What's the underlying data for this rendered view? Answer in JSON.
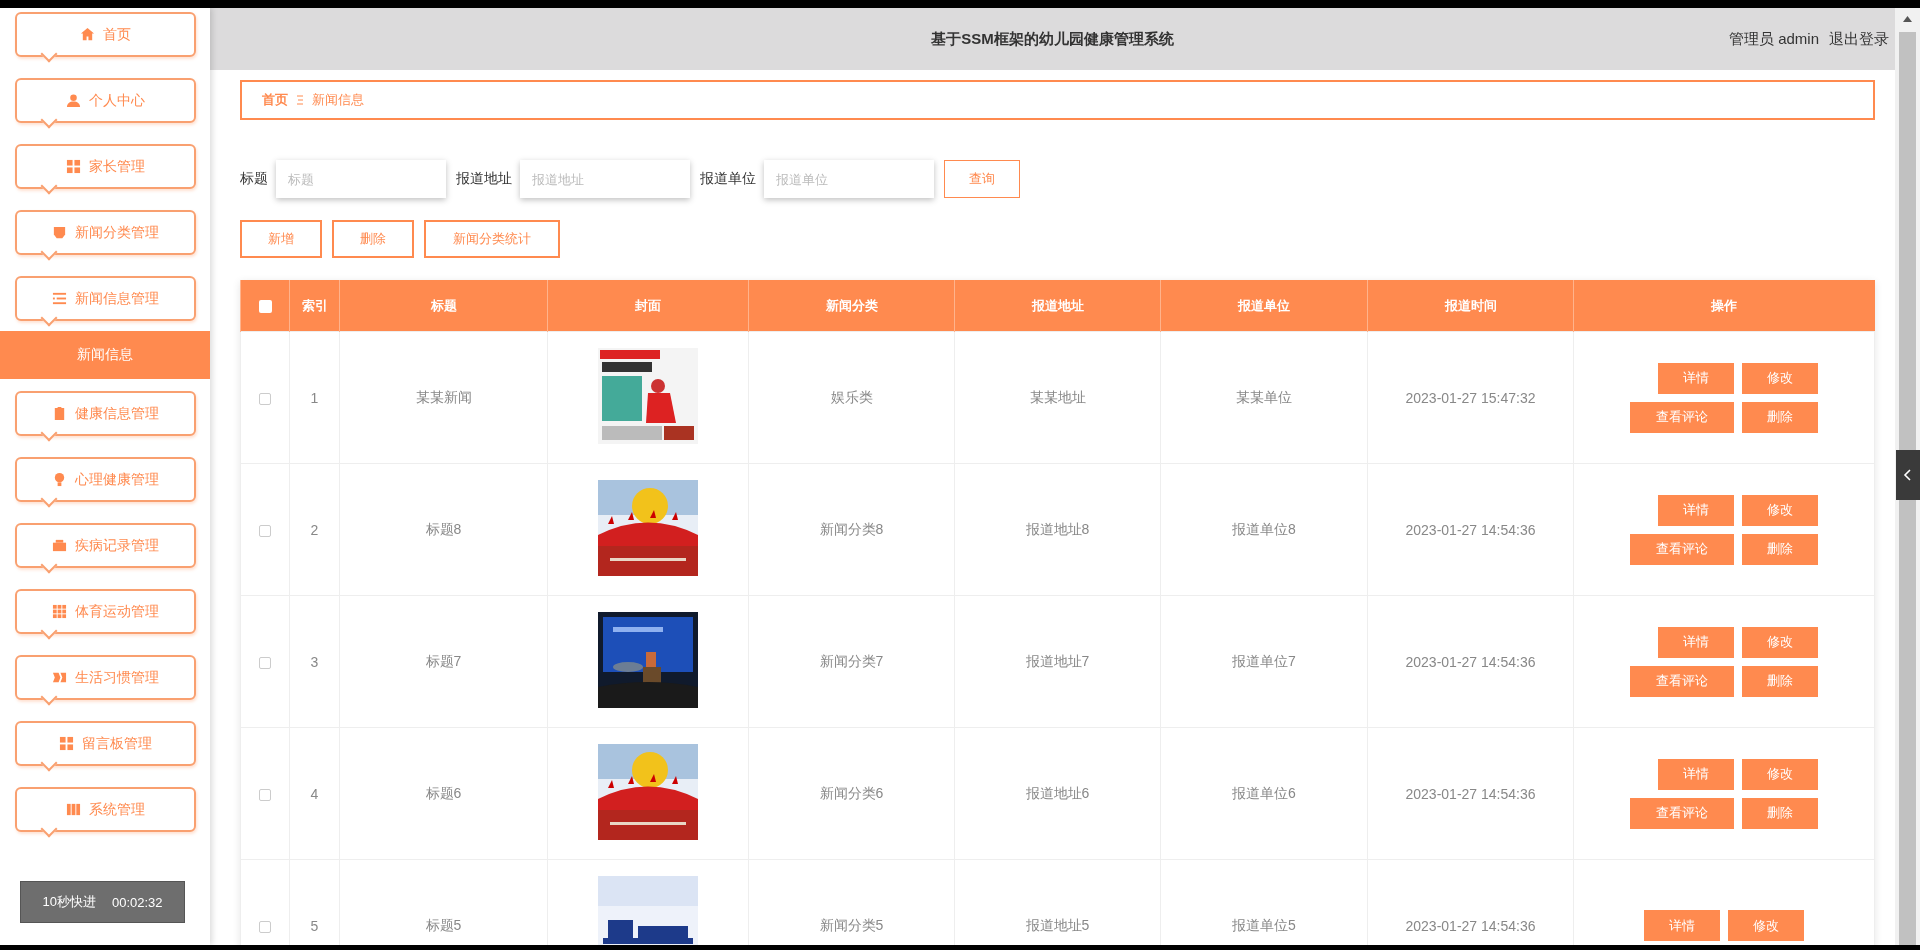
{
  "sidebar": {
    "items": [
      {
        "label": "首页",
        "selected": false
      },
      {
        "label": "个人中心",
        "selected": false
      },
      {
        "label": "家长管理",
        "selected": false
      },
      {
        "label": "新闻分类管理",
        "selected": false
      },
      {
        "label": "新闻信息管理",
        "selected": false,
        "expanded": true,
        "children": [
          {
            "label": "新闻信息",
            "selected": true
          }
        ]
      },
      {
        "label": "健康信息管理",
        "selected": false
      },
      {
        "label": "心理健康管理",
        "selected": false
      },
      {
        "label": "疾病记录管理",
        "selected": false
      },
      {
        "label": "体育运动管理",
        "selected": false
      },
      {
        "label": "生活习惯管理",
        "selected": false
      },
      {
        "label": "留言板管理",
        "selected": false
      },
      {
        "label": "系统管理",
        "selected": false
      }
    ]
  },
  "header": {
    "title": "基于SSM框架的幼儿园健康管理系统",
    "user": "管理员 admin",
    "logout": "退出登录"
  },
  "breadcrumb": [
    "首页",
    "新闻信息"
  ],
  "search": {
    "fields": [
      {
        "label": "标题",
        "placeholder": "标题"
      },
      {
        "label": "报道地址",
        "placeholder": "报道地址"
      },
      {
        "label": "报道单位",
        "placeholder": "报道单位"
      }
    ],
    "button": "查询"
  },
  "actions": [
    "新增",
    "删除",
    "新闻分类统计"
  ],
  "table": {
    "select_all_checked": false,
    "columns": [
      "索引",
      "标题",
      "封面",
      "新闻分类",
      "报道地址",
      "报道单位",
      "报道时间",
      "操作"
    ],
    "rows": [
      {
        "checked": false,
        "index": "1",
        "title": "某某新闻",
        "category": "娱乐类",
        "address": "某某地址",
        "unit": "某某单位",
        "time": "2023-01-27 15:47:32",
        "actions": [
          "详情",
          "修改",
          "查看评论",
          "删除"
        ]
      },
      {
        "checked": false,
        "index": "2",
        "title": "标题8",
        "category": "新闻分类8",
        "address": "报道地址8",
        "unit": "报道单位8",
        "time": "2023-01-27 14:54:36",
        "actions": [
          "详情",
          "修改",
          "查看评论",
          "删除"
        ]
      },
      {
        "checked": false,
        "index": "3",
        "title": "标题7",
        "category": "新闻分类7",
        "address": "报道地址7",
        "unit": "报道单位7",
        "time": "2023-01-27 14:54:36",
        "actions": [
          "详情",
          "修改",
          "查看评论",
          "删除"
        ]
      },
      {
        "checked": false,
        "index": "4",
        "title": "标题6",
        "category": "新闻分类6",
        "address": "报道地址6",
        "unit": "报道单位6",
        "time": "2023-01-27 14:54:36",
        "actions": [
          "详情",
          "修改",
          "查看评论",
          "删除"
        ]
      },
      {
        "checked": false,
        "index": "5",
        "title": "标题5",
        "category": "新闻分类5",
        "address": "报道地址5",
        "unit": "报道单位5",
        "time": "2023-01-27 14:54:36",
        "actions": [
          "详情",
          "修改"
        ]
      }
    ]
  },
  "video_overlay": {
    "label": "10秒快进",
    "time": "00:02:32"
  }
}
